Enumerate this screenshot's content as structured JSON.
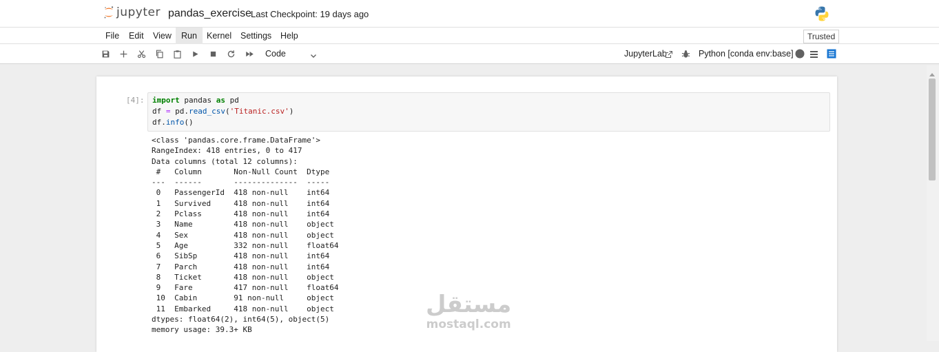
{
  "header": {
    "logo_text": "jupyter",
    "notebook_title": "pandas_exercise",
    "checkpoint": "Last Checkpoint: 19 days ago"
  },
  "menu": {
    "items": [
      "File",
      "Edit",
      "View",
      "Run",
      "Kernel",
      "Settings",
      "Help"
    ],
    "active": "Run"
  },
  "trusted_label": "Trusted",
  "toolbar": {
    "cell_type": "Code",
    "jupyterlab_link": "JupyterLab",
    "kernel": "Python [conda env:base] *",
    "icons": [
      "save-icon",
      "add-cell-icon",
      "cut-icon",
      "copy-icon",
      "paste-icon",
      "run-icon",
      "stop-icon",
      "restart-icon",
      "fast-forward-icon"
    ]
  },
  "cell": {
    "prompt": "[4]:",
    "code": {
      "line1": {
        "kw1": "import",
        "mid": " pandas ",
        "kw2": "as",
        "end": " pd"
      },
      "line2": {
        "a": "df ",
        "op": "=",
        "b": " pd.",
        "fn": "read_csv",
        "c": "(",
        "str": "'Titanic.csv'",
        "d": ")"
      },
      "line3": {
        "a": "df.",
        "fn": "info",
        "c": "()"
      }
    },
    "output": "<class 'pandas.core.frame.DataFrame'>\nRangeIndex: 418 entries, 0 to 417\nData columns (total 12 columns):\n #   Column       Non-Null Count  Dtype  \n---  ------       --------------  -----  \n 0   PassengerId  418 non-null    int64  \n 1   Survived     418 non-null    int64  \n 2   Pclass       418 non-null    int64  \n 3   Name         418 non-null    object \n 4   Sex          418 non-null    object \n 5   Age          332 non-null    float64\n 6   SibSp        418 non-null    int64  \n 7   Parch        418 non-null    int64  \n 8   Ticket       418 non-null    object \n 9   Fare         417 non-null    float64\n 10  Cabin        91 non-null     object \n 11  Embarked     418 non-null    object \ndtypes: float64(2), int64(5), object(5)\nmemory usage: 39.3+ KB"
  },
  "watermark": {
    "arabic": "مستقل",
    "latin": "mostaql.com"
  },
  "colors": {
    "jupyter_orange": "#f37726",
    "python_blue": "#3776ab",
    "python_yellow": "#ffd43b",
    "active_icon_blue": "#1976d2"
  }
}
